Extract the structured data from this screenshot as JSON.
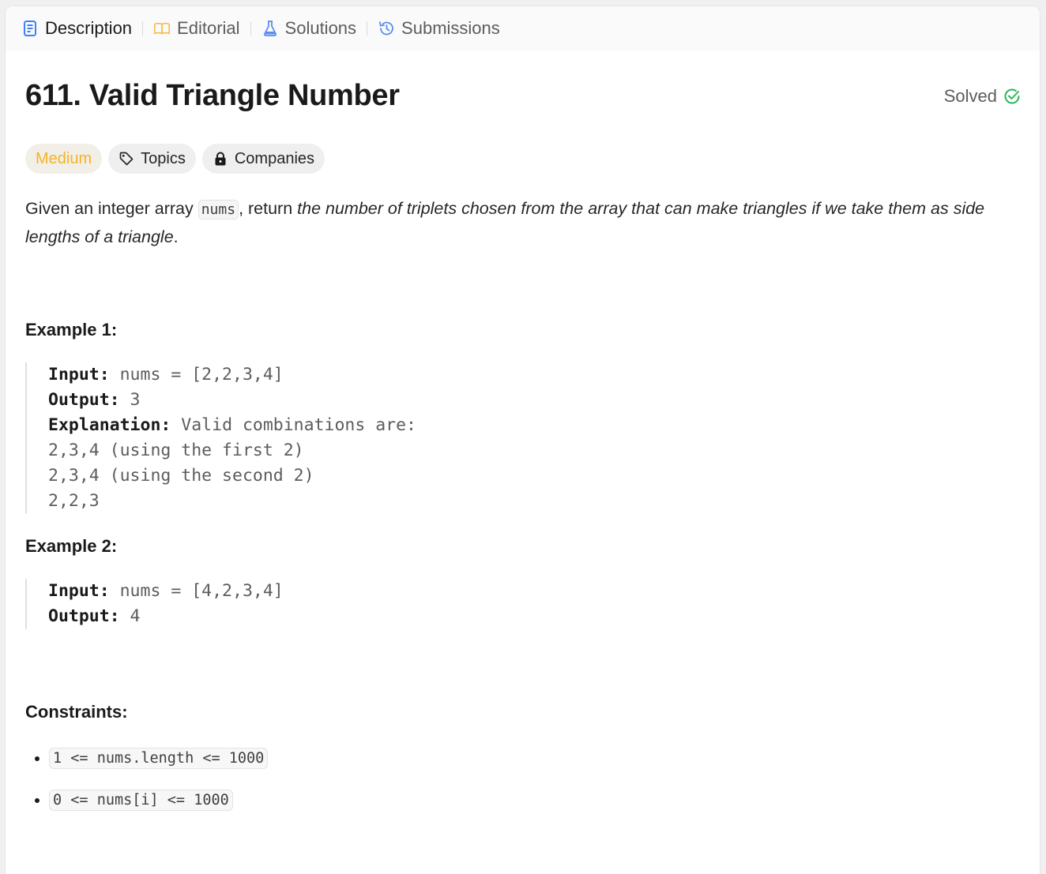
{
  "tabs": [
    {
      "label": "Description",
      "icon": "description-icon"
    },
    {
      "label": "Editorial",
      "icon": "book-icon"
    },
    {
      "label": "Solutions",
      "icon": "flask-icon"
    },
    {
      "label": "Submissions",
      "icon": "history-icon"
    }
  ],
  "problem": {
    "title": "611. Valid Triangle Number",
    "status": "Solved",
    "difficulty": "Medium",
    "topics_label": "Topics",
    "companies_label": "Companies",
    "desc_prefix": "Given an integer array ",
    "desc_code": "nums",
    "desc_middle": ", return ",
    "desc_italic": "the number of triplets chosen from the array that can make triangles if we take them as side lengths of a triangle",
    "desc_suffix": "."
  },
  "examples": [
    {
      "heading": "Example 1:",
      "input_label": "Input:",
      "input_value": " nums = [2,2,3,4]",
      "output_label": "Output:",
      "output_value": " 3",
      "explanation_label": "Explanation:",
      "explanation_value": " Valid combinations are: ",
      "explanation_lines": [
        "2,3,4 (using the first 2)",
        "2,3,4 (using the second 2)",
        "2,2,3"
      ]
    },
    {
      "heading": "Example 2:",
      "input_label": "Input:",
      "input_value": " nums = [4,2,3,4]",
      "output_label": "Output:",
      "output_value": " 4"
    }
  ],
  "constraints": {
    "heading": "Constraints:",
    "items": [
      "1 <= nums.length <= 1000",
      "0 <= nums[i] <= 1000"
    ]
  },
  "colors": {
    "accent_blue": "#3b82f6",
    "medium_yellow": "#f5b326",
    "solved_green": "#2db55d",
    "editorial_orange": "#f5b740"
  }
}
